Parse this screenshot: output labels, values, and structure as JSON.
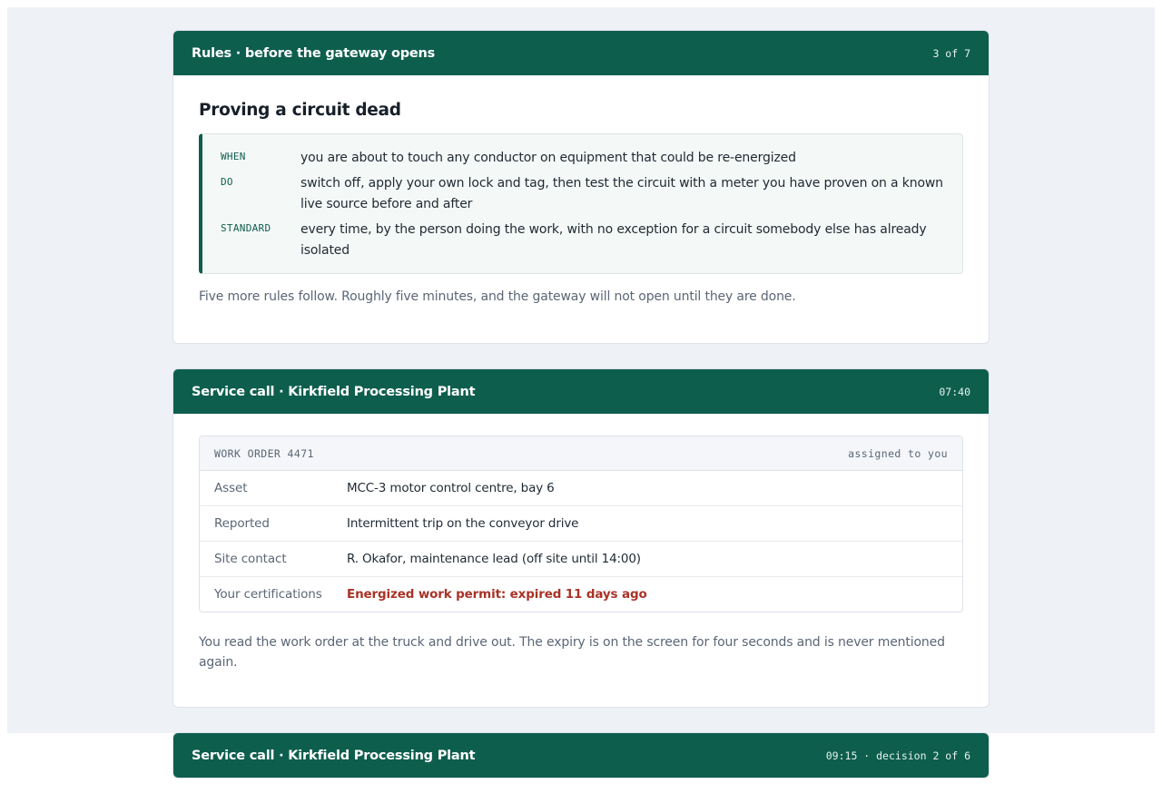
{
  "rules_card": {
    "title": "Rules · before the gateway opens",
    "progress": "3 of 7",
    "rule_title": "Proving a circuit dead",
    "rows": [
      {
        "key": "WHEN",
        "value": "you are about to touch any conductor on equipment that could be re-energized"
      },
      {
        "key": "DO",
        "value": "switch off, apply your own lock and tag, then test the circuit with a meter you have proven on a known live source before and after"
      },
      {
        "key": "STANDARD",
        "value": "every time, by the person doing the work, with no exception for a circuit somebody else has already isolated"
      }
    ],
    "note": "Five more rules follow. Roughly five minutes, and the gateway will not open until they are done."
  },
  "service_card": {
    "title": "Service call · Kirkfield Processing Plant",
    "time": "07:40",
    "work_order": {
      "id_label": "WORK ORDER 4471",
      "assignment": "assigned to you",
      "rows": [
        {
          "label": "Asset",
          "value": "MCC-3 motor control centre, bay 6"
        },
        {
          "label": "Reported",
          "value": "Intermittent trip on the conveyor drive"
        },
        {
          "label": "Site contact",
          "value": "R. Okafor, maintenance lead (off site until 14:00)"
        },
        {
          "label": "Your certifications",
          "value": "Energized work permit: expired 11 days ago"
        }
      ]
    },
    "note": "You read the work order at the truck and drive out. The expiry is on the screen for four seconds and is never mentioned again."
  },
  "decision_card": {
    "title": "Service call · Kirkfield Processing Plant",
    "meta": "09:15 · decision 2 of 6"
  },
  "colors": {
    "header": "#0e5e4e",
    "warning": "#a93226",
    "page_background": "#eef1f5"
  }
}
